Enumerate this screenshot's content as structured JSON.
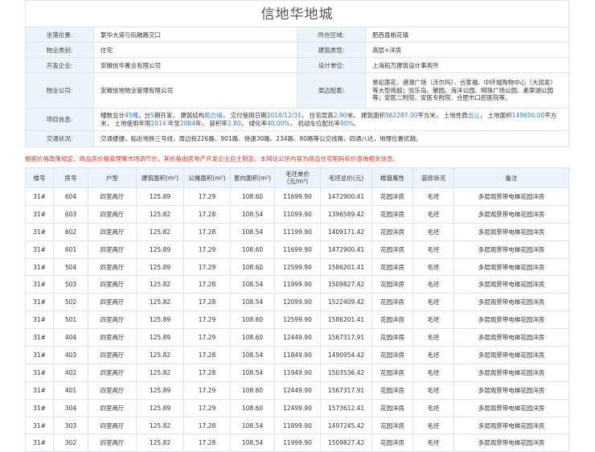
{
  "title": "信地华地城",
  "info": {
    "location_label": "坐落位置:",
    "location": "繁华大道与玩融路交口",
    "area_label": "所在区域:",
    "area": "肥西县桃花镇",
    "type_label": "物业类别:",
    "type": "住宅",
    "building_type_label": "建筑类型:",
    "building_type": "高层+洋房",
    "developer_label": "开发企业:",
    "developer": "安徽信华置业有限公司",
    "designer_label": "设计单位:",
    "designer": "上海拓万建筑设计事务所",
    "property_mgmt_label": "物业公司:",
    "property_mgmt": "安徽信地物业管理有限公司",
    "surroundings_label": "周边配套:",
    "surroundings": "易初莲花、港澳广场（沃尔玛）、合家福、中环城购物中心（大润发）等大型商超；欢乐岛、徽园、海洋公园、明珠广场公园、素翠湖公园等；安医二附院、安医专附院、合肥市口腔医院等。",
    "project_label": "项目信息:",
    "project": {
      "p1": "幢数总计",
      "buildings": "45幢",
      "p2": "，分",
      "phases": "5",
      "p3": "期开发， 建筑结构",
      "structure": "剪力墙",
      "p4": "， 交付使用日期",
      "delivery": "2018/12/31",
      "p5": "， 住宅层高",
      "height": "2.90",
      "p6": "米， 建筑面积",
      "build_area": "562287.00",
      "p7": "平方米， 土地性质",
      "land_type": "出让",
      "p8": "， 土地面积",
      "land_area": "149650.00",
      "p9": "平方米， 土地使用年限",
      "start_year": "2014",
      "p10": " 年至",
      "end_year": "2084",
      "p11": "年， 容积率",
      "far": "2.80",
      "p12": "， 绿化率",
      "green": "40.00%",
      "p13": "， 机动车位配比率",
      "parking": "90%",
      "p14": "。"
    },
    "traffic_label": "交通状况:",
    "traffic": "交通便捷，临近地铁三号线，周边有226路、901路、快速30路、234路、80路等公交线路，四通八达，地理位置优越。"
  },
  "notice": "根据价格政策规定，商品房价格管理属市场调节价，其价格由房地产开发企业自主制定，本网站公示内容为商品住宅明码标价查询相关信息。",
  "columns": [
    "楼号",
    "房号",
    "户型",
    "建筑面积(m²)",
    "公摊面积(m²)",
    "套内面积(m²)",
    "毛坯单价\n(元/m²)",
    "毛坯总价(元)",
    "楼盘属性",
    "装修状况",
    "备注"
  ],
  "rows": [
    [
      "31#",
      "604",
      "四室两厅",
      "125.89",
      "17.29",
      "108.60",
      "11699.90",
      "1472900.41",
      "花园洋房",
      "毛坯",
      "多层观景带电梯花园洋房"
    ],
    [
      "31#",
      "603",
      "四室两厅",
      "125.82",
      "17.28",
      "108.54",
      "11099.90",
      "1396589.42",
      "花园洋房",
      "毛坯",
      "多层观景带电梯花园洋房"
    ],
    [
      "31#",
      "602",
      "四室两厅",
      "125.82",
      "17.28",
      "108.54",
      "11199.90",
      "1409171.42",
      "花园洋房",
      "毛坯",
      "多层观景带电梯花园洋房"
    ],
    [
      "31#",
      "601",
      "四室两厅",
      "125.89",
      "17.29",
      "108.60",
      "11699.90",
      "1472900.41",
      "花园洋房",
      "毛坯",
      "多层观景带电梯花园洋房"
    ],
    [
      "31#",
      "504",
      "四室两厅",
      "125.89",
      "17.29",
      "108.60",
      "12599.90",
      "1586201.41",
      "花园洋房",
      "毛坯",
      "多层观景带电梯花园洋房"
    ],
    [
      "31#",
      "503",
      "四室两厅",
      "125.82",
      "17.28",
      "108.54",
      "11999.90",
      "1509827.42",
      "花园洋房",
      "毛坯",
      "多层观景带电梯花园洋房"
    ],
    [
      "31#",
      "502",
      "四室两厅",
      "125.82",
      "17.28",
      "108.54",
      "12099.90",
      "1522409.42",
      "花园洋房",
      "毛坯",
      "多层观景带电梯花园洋房"
    ],
    [
      "31#",
      "501",
      "四室两厅",
      "125.89",
      "17.29",
      "108.60",
      "12599.90",
      "1586201.41",
      "花园洋房",
      "毛坯",
      "多层观景带电梯花园洋房"
    ],
    [
      "31#",
      "404",
      "四室两厅",
      "125.89",
      "17.29",
      "108.60",
      "12449.90",
      "1567317.91",
      "花园洋房",
      "毛坯",
      "多层观景带电梯花园洋房"
    ],
    [
      "31#",
      "403",
      "四室两厅",
      "125.82",
      "17.28",
      "108.54",
      "11849.90",
      "1490954.42",
      "花园洋房",
      "毛坯",
      "多层观景带电梯花园洋房"
    ],
    [
      "31#",
      "402",
      "四室两厅",
      "125.82",
      "17.28",
      "108.54",
      "11949.90",
      "1503536.42",
      "花园洋房",
      "毛坯",
      "多层观景带电梯花园洋房"
    ],
    [
      "31#",
      "401",
      "四室两厅",
      "125.89",
      "17.29",
      "108.60",
      "12449.90",
      "1567317.91",
      "花园洋房",
      "毛坯",
      "多层观景带电梯花园洋房"
    ],
    [
      "31#",
      "304",
      "四室两厅",
      "125.89",
      "17.29",
      "108.60",
      "12499.90",
      "1573612.41",
      "花园洋房",
      "毛坯",
      "多层观景带电梯花园洋房"
    ],
    [
      "31#",
      "303",
      "四室两厅",
      "125.82",
      "17.28",
      "108.54",
      "11899.90",
      "1497245.42",
      "花园洋房",
      "毛坯",
      "多层观景带电梯花园洋房"
    ],
    [
      "31#",
      "302",
      "四室两厅",
      "125.82",
      "17.28",
      "108.54",
      "11999.90",
      "1509827.42",
      "花园洋房",
      "毛坯",
      "多层观景带电梯花园洋房"
    ]
  ],
  "colors": {
    "label_bg": "#eef4fb",
    "border": "#dfe5ec",
    "notice": "#d13b2c",
    "highlight": "#2d7ccf"
  }
}
